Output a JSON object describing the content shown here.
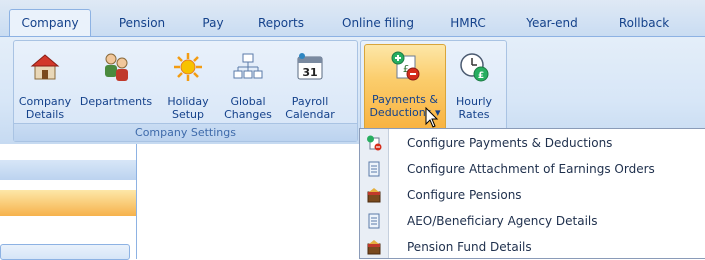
{
  "tabs": [
    {
      "label": "Company",
      "active": true
    },
    {
      "label": "Pension"
    },
    {
      "label": "Pay"
    },
    {
      "label": "Reports"
    },
    {
      "label": "Online filing"
    },
    {
      "label": "HMRC"
    },
    {
      "label": "Year-end"
    },
    {
      "label": "Rollback"
    }
  ],
  "ribbon": {
    "company_settings": {
      "group_label": "Company Settings",
      "buttons": [
        {
          "label_line1": "Company",
          "label_line2": "Details",
          "icon": "house-icon"
        },
        {
          "label_line1": "Departments",
          "label_line2": "",
          "icon": "people-icon"
        },
        {
          "label_line1": "Holiday",
          "label_line2": "Setup",
          "icon": "sun-icon"
        },
        {
          "label_line1": "Global",
          "label_line2": "Changes",
          "icon": "org-chart-icon"
        },
        {
          "label_line1": "Payroll",
          "label_line2": "Calendar",
          "icon": "calendar-icon"
        }
      ]
    },
    "pay_group": {
      "buttons": [
        {
          "label_line1": "Payments &",
          "label_line2": "Deductions",
          "icon": "payments-deductions-icon",
          "dropdown_arrow": "▾"
        },
        {
          "label_line1": "Hourly",
          "label_line2": "Rates",
          "icon": "clock-pound-icon"
        }
      ]
    }
  },
  "menu": {
    "items": [
      {
        "label": "Configure Payments & Deductions",
        "icon": "payments-deductions-icon"
      },
      {
        "label": "Configure Attachment of Earnings Orders",
        "icon": "document-icon"
      },
      {
        "label": "Configure Pensions",
        "icon": "pension-icon"
      },
      {
        "label": "AEO/Beneficiary Agency Details",
        "icon": "document-icon"
      },
      {
        "label": "Pension Fund Details",
        "icon": "pension-icon"
      }
    ]
  },
  "colors": {
    "ribbon_text": "#15428b",
    "highlight": "#fbcd6c",
    "menu_text": "#1e2f4c"
  }
}
